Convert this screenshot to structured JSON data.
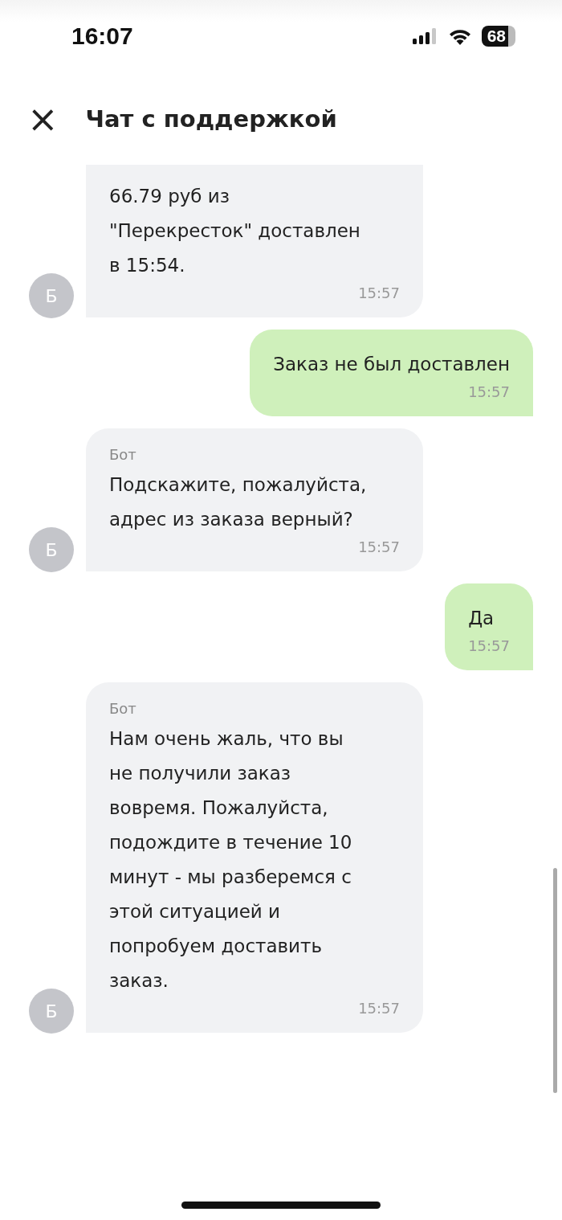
{
  "status_bar": {
    "time": "16:07",
    "battery": "68"
  },
  "header": {
    "close": "×",
    "title": "Чат с поддержкой"
  },
  "messages": [
    {
      "kind": "bot",
      "avatar": "Б",
      "lines": [
        "66.79 руб из",
        "\"Перекресток\" доставлен",
        "в 15:54."
      ],
      "time": "15:57",
      "cut": true
    },
    {
      "kind": "user",
      "lines": [
        "Заказ не был доставлен"
      ],
      "time": "15:57"
    },
    {
      "kind": "bot",
      "avatar": "Б",
      "sender": "Бот",
      "lines": [
        "Подскажите, пожалуйста,",
        "адрес из заказа верный?"
      ],
      "time": "15:57"
    },
    {
      "kind": "user",
      "lines": [
        "Да"
      ],
      "time": "15:57"
    },
    {
      "kind": "bot",
      "avatar": "Б",
      "sender": "Бот",
      "lines": [
        "Нам очень жаль, что вы",
        "не получили заказ",
        "вовремя. Пожалуйста,",
        "подождите в течение 10",
        "минут - мы разберемся с",
        "этой ситуацией и",
        "попробуем доставить",
        "заказ."
      ],
      "time": "15:57"
    }
  ]
}
